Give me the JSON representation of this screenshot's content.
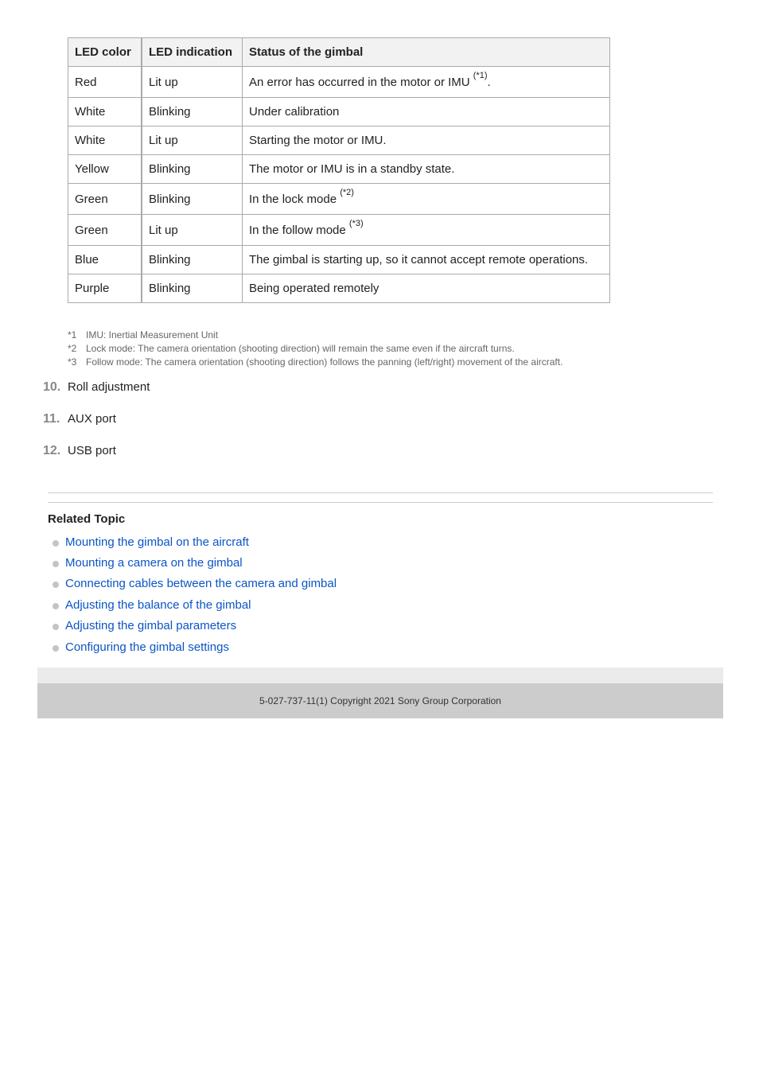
{
  "table": {
    "headers": [
      "LED color",
      "LED indication",
      "Status of the gimbal"
    ],
    "rows": [
      {
        "color": "Red",
        "indication": "Lit up",
        "status": "An error has occurred in the motor or IMU ",
        "note": "(*1)",
        "suffix": "."
      },
      {
        "color": "White",
        "indication": "Blinking",
        "status": "Under calibration",
        "note": "",
        "suffix": ""
      },
      {
        "color": "White",
        "indication": "Lit up",
        "status": "Starting the motor or IMU.",
        "note": "",
        "suffix": ""
      },
      {
        "color": "Yellow",
        "indication": "Blinking",
        "status": "The motor or IMU is in a standby state.",
        "note": "",
        "suffix": ""
      },
      {
        "color": "Green",
        "indication": "Blinking",
        "status": "In the lock mode ",
        "note": "(*2)",
        "suffix": ""
      },
      {
        "color": "Green",
        "indication": "Lit up",
        "status": "In the follow mode ",
        "note": "(*3)",
        "suffix": ""
      },
      {
        "color": "Blue",
        "indication": "Blinking",
        "status": "The gimbal is starting up, so it cannot accept remote operations.",
        "note": "",
        "suffix": ""
      },
      {
        "color": "Purple",
        "indication": "Blinking",
        "status": "Being operated remotely",
        "note": "",
        "suffix": ""
      }
    ]
  },
  "notes": [
    {
      "mark": "*1",
      "text": "IMU: Inertial Measurement Unit"
    },
    {
      "mark": "*2",
      "text": "Lock mode: The camera orientation (shooting direction) will remain the same even if the aircraft turns."
    },
    {
      "mark": "*3",
      "text": "Follow mode: The camera orientation (shooting direction) follows the panning (left/right) movement of the aircraft."
    }
  ],
  "steps": [
    {
      "num": "10.",
      "label": "Roll adjustment"
    },
    {
      "num": "11.",
      "label": "AUX port"
    },
    {
      "num": "12.",
      "label": "USB port"
    }
  ],
  "related": {
    "title": "Related Topic",
    "links": [
      "Mounting the gimbal on the aircraft",
      "Mounting a camera on the gimbal",
      "Connecting cables between the camera and gimbal",
      "Adjusting the balance of the gimbal",
      "Adjusting the gimbal parameters",
      "Configuring the gimbal settings"
    ]
  },
  "footer": {
    "copyright": "5-027-737-11(1) Copyright 2021 Sony Group Corporation"
  },
  "colors": {
    "link": "#0b55c5",
    "footer_bg": "#cccccc"
  }
}
